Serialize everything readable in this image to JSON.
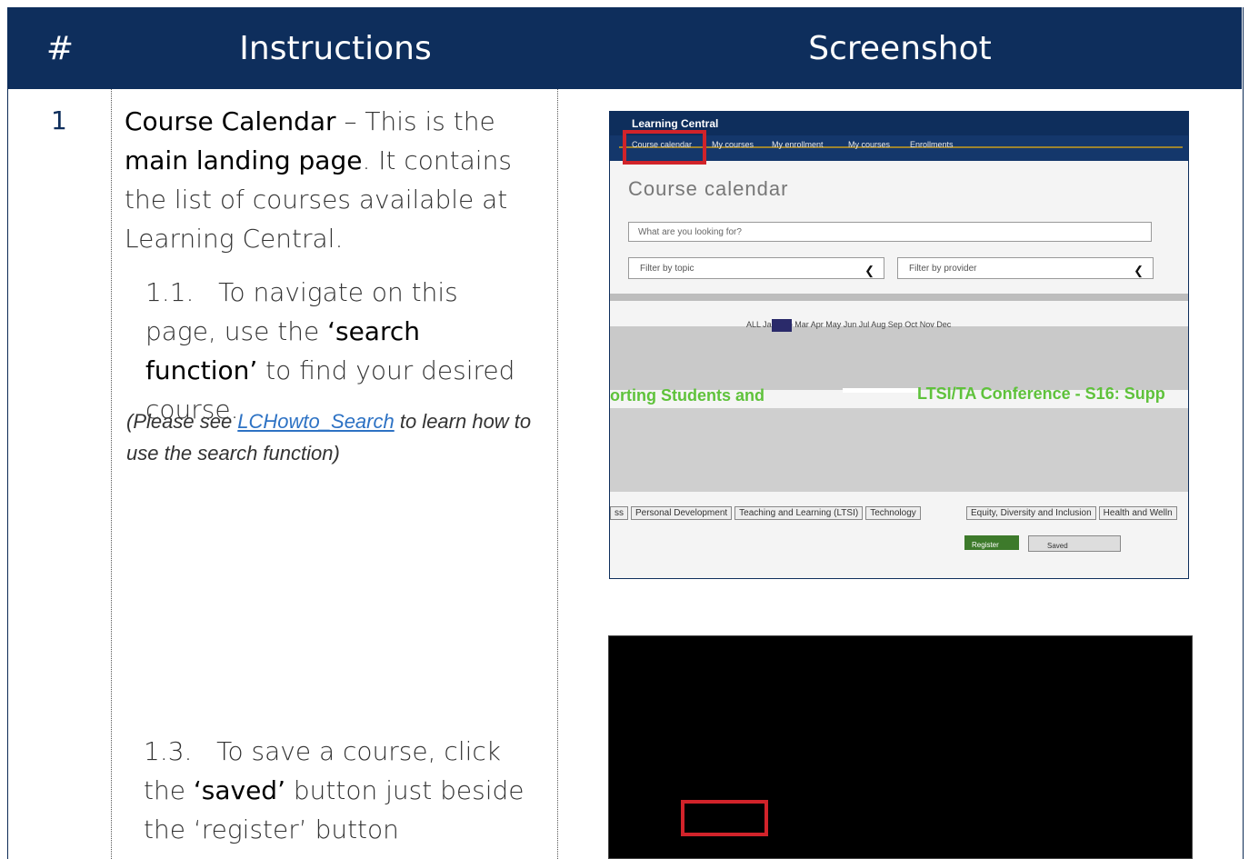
{
  "header": {
    "num": "#",
    "instructions": "Instructions",
    "screenshot": "Screenshot"
  },
  "row": {
    "number": "1",
    "intro": {
      "bold1": "Course Calendar",
      "text1": " – This is the ",
      "bold2": "main landing page",
      "text2": ". It contains the list of courses available at Learning Central."
    },
    "step1": {
      "num": "1.1.",
      "text1": "To navigate on this page, use the ",
      "bold": "‘search function’",
      "text2": " to find your desired course."
    },
    "note": {
      "text1": "(Please see ",
      "link": "LCHowto_Search",
      "text2": " to learn how to use the search function)"
    },
    "step3": {
      "num": "1.3.",
      "text1": "To save a course, click the ",
      "bold": "‘saved’",
      "text2": " button just beside the ‘register’ button"
    }
  },
  "shot1": {
    "app_title": "Learning Central",
    "nav": [
      "Course calendar",
      "My courses",
      "My enrollment",
      "My courses",
      "Enrollments"
    ],
    "page_title": "Course calendar",
    "search_placeholder": "What are you looking for?",
    "filter_topic": "Filter by topic",
    "filter_provider": "Filter by provider",
    "months": "ALL Jan Feb Mar Apr May Jun Jul Aug Sep Oct Nov Dec",
    "course_left": "orting Students and",
    "course_right": "LTSI/TA Conference - S16: Supp",
    "tags_left": [
      "ss",
      "Personal Development",
      "Teaching and Learning (LTSI)",
      "Technology"
    ],
    "tags_right": [
      "Equity, Diversity and Inclusion",
      "Health and Welln"
    ],
    "register": "Register",
    "saved": "Saved"
  },
  "colors": {
    "header_bg": "#0e2e5c",
    "highlight": "#d1232a",
    "course_green": "#5fc23b",
    "link": "#2d72c4"
  }
}
